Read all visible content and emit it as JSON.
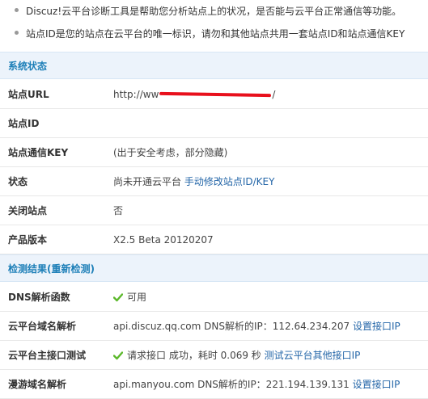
{
  "tips": [
    "Discuz!云平台诊断工具是帮助您分析站点上的状况，是否能与云平台正常通信等功能。",
    "站点ID是您的站点在云平台的唯一标识，请勿和其他站点共用一套站点ID和站点通信KEY"
  ],
  "system_status": {
    "title": "系统状态",
    "rows": [
      {
        "label": "站点URL",
        "value_prefix": "http://ww",
        "value_suffix": "/"
      },
      {
        "label": "站点ID",
        "value": ""
      },
      {
        "label": "站点通信KEY",
        "value": "(出于安全考虑，部分隐藏)"
      },
      {
        "label": "状态",
        "value": "尚未开通云平台",
        "link": "手动修改站点ID/KEY"
      },
      {
        "label": "关闭站点",
        "value": "否"
      },
      {
        "label": "产品版本",
        "value": "X2.5 Beta 20120207"
      }
    ]
  },
  "detection": {
    "title": "检测结果",
    "recheck_link": "(重新检测)",
    "rows": [
      {
        "label": "DNS解析函数",
        "status_icon": "check-icon",
        "value": "可用"
      },
      {
        "label": "云平台域名解析",
        "value": "api.discuz.qq.com DNS解析的IP：112.64.234.207",
        "link": "设置接口IP"
      },
      {
        "label": "云平台主接口测试",
        "status_icon": "check-icon",
        "value": "请求接口 成功，耗时 0.069 秒",
        "link": "测试云平台其他接口IP"
      },
      {
        "label": "漫游域名解析",
        "value": "api.manyou.com DNS解析的IP：221.194.139.131",
        "link": "设置接口IP"
      }
    ]
  },
  "colors": {
    "accent": "#1d7fb8",
    "link": "#2466a8",
    "check": "#5bb82a",
    "redaction": "#e8101c"
  }
}
